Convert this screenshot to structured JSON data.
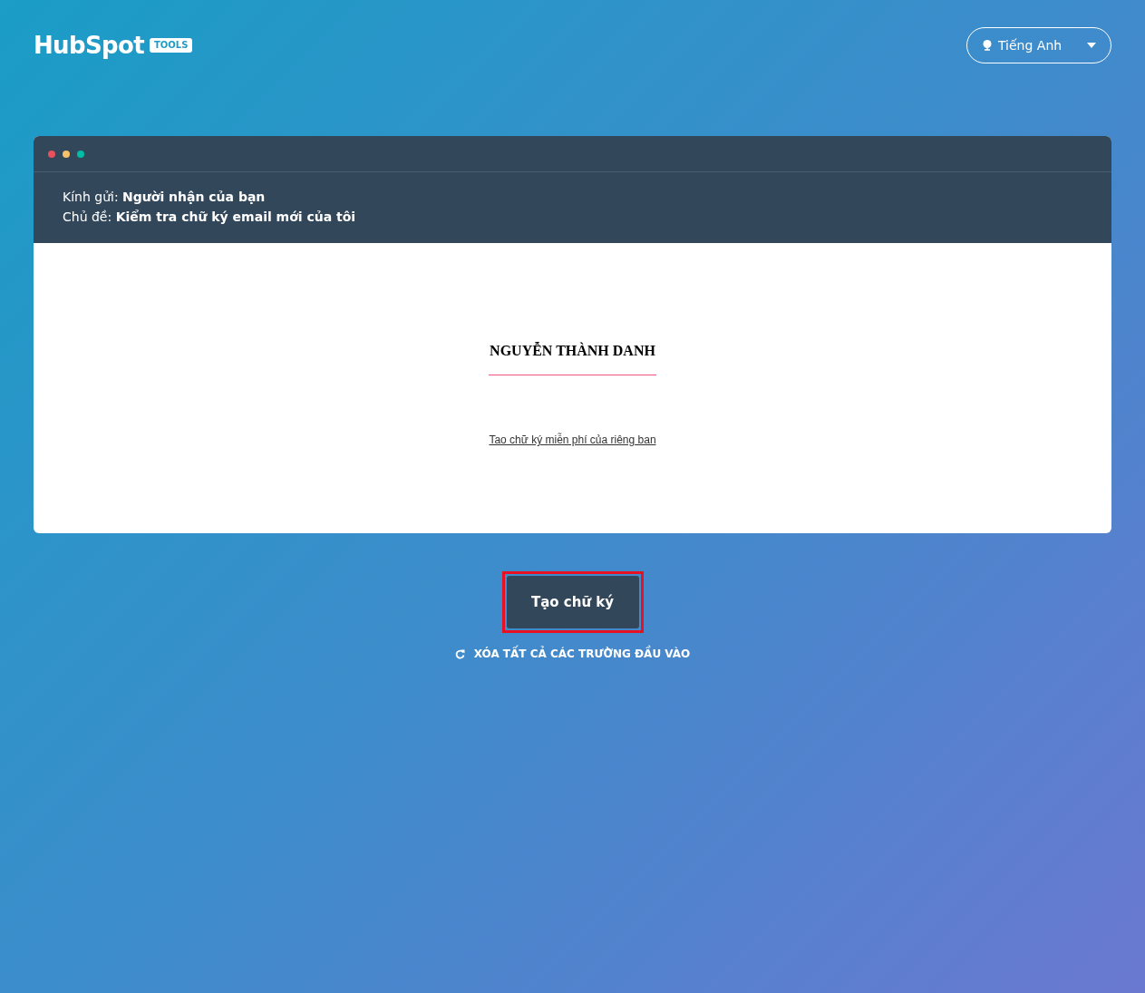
{
  "header": {
    "logo": "HubSpot",
    "logo_badge": "TOOLS",
    "language": "Tiếng Anh"
  },
  "email_preview": {
    "dots": [
      {
        "color": "#e8505b"
      },
      {
        "color": "#f5c26b"
      },
      {
        "color": "#00bda5"
      }
    ],
    "to_label": "Kính gửi:",
    "to_value": "Người nhận của bạn",
    "subject_label": "Chủ đề:",
    "subject_value": "Kiểm tra chữ ký email mới của tôi",
    "signature_name": "NGUYỄN THÀNH DANH",
    "signature_link": "Tao chữ ký miễn phí của riêng ban"
  },
  "create_button": {
    "label": "Tạo chữ ký",
    "highlighted": true
  },
  "reset_link": "XÓA TẤT CẢ CÁC TRƯỜNG ĐẦU VÀO"
}
